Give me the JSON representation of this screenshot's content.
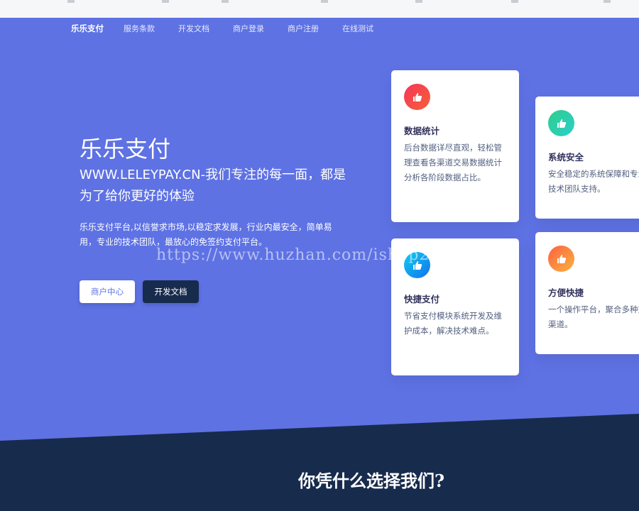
{
  "nav": {
    "brand": "乐乐支付",
    "items": [
      "服务条款",
      "开发文档",
      "商户登录",
      "商户注册",
      "在线测试"
    ]
  },
  "hero": {
    "title": "乐乐支付",
    "subtitle": "WWW.LELEYPAY.CN-我们专注的每一面，都是为了给你更好的体验",
    "description": "乐乐支付平台,以信誉求市场,以稳定求发展，行业内最安全，简单易用，专业的技术团队，最放心的免签约支付平台。",
    "primary_button": "商户中心",
    "secondary_button": "开发文档"
  },
  "watermark": "https://www.huzhan.com/ishop29436",
  "cards": [
    {
      "icon": "thumb-up-icon",
      "title": "数据统计",
      "desc": "后台数据详尽直观，轻松管理查看各渠道交易数据统计分析各阶段数据占比。"
    },
    {
      "icon": "thumb-up-icon",
      "title": "系统安全",
      "desc": "安全稳定的系统保障和专业的技术团队支持。"
    },
    {
      "icon": "thumb-up-icon",
      "title": "快捷支付",
      "desc": "节省支付模块系统开发及维护成本，解决技术难点。"
    },
    {
      "icon": "thumb-up-icon",
      "title": "方便快捷",
      "desc": "一个操作平台，聚合多种交易渠道。"
    }
  ],
  "section": {
    "heading": "你凭什么选择我们?"
  },
  "colors": {
    "primary": "#5e72e4",
    "dark": "#172b4d",
    "red": "#f5365c",
    "green": "#2dce89",
    "blue": "#11cdef",
    "orange": "#fb6340"
  }
}
